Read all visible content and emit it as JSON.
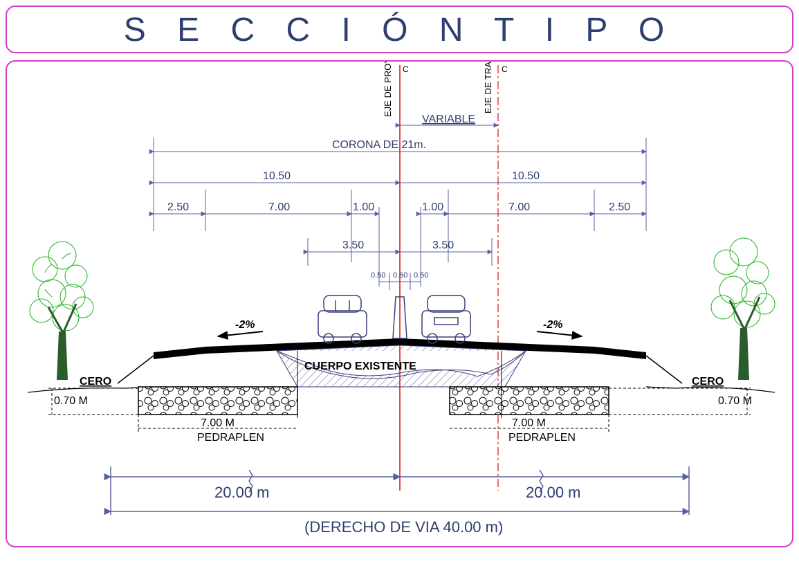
{
  "title": "S E C C I Ó N  T I P O",
  "axes": {
    "proyecto": "EJE DE PROYECTO",
    "trazo": "EJE DE TRAZO",
    "variable": "VARIABLE"
  },
  "dims": {
    "corona": "CORONA DE 21m.",
    "half_left": "10.50",
    "half_right": "10.50",
    "shoulder_l": "2.50",
    "lane_l": "7.00",
    "median_l": "1.00",
    "median_r": "1.00",
    "lane_r": "7.00",
    "shoulder_r": "2.50",
    "lane_half_l": "3.50",
    "lane_half_r": "3.50",
    "barrier_l": "0.50",
    "barrier_m": "0.60",
    "barrier_r": "0.50"
  },
  "slope": {
    "left": "-2%",
    "right": "-2%"
  },
  "body": "CUERPO EXISTENTE",
  "ground": {
    "cero_l": "CERO",
    "cero_r": "CERO",
    "depth_l": "0.70 M",
    "depth_r": "0.70 M",
    "ped_dim_l": "7.00 M",
    "ped_dim_r": "7.00 M",
    "ped_label": "PEDRAPLEN"
  },
  "row": {
    "half_l": "20.00 m",
    "half_r": "20.00 m",
    "total": "(DERECHO DE VIA 40.00 m)"
  }
}
